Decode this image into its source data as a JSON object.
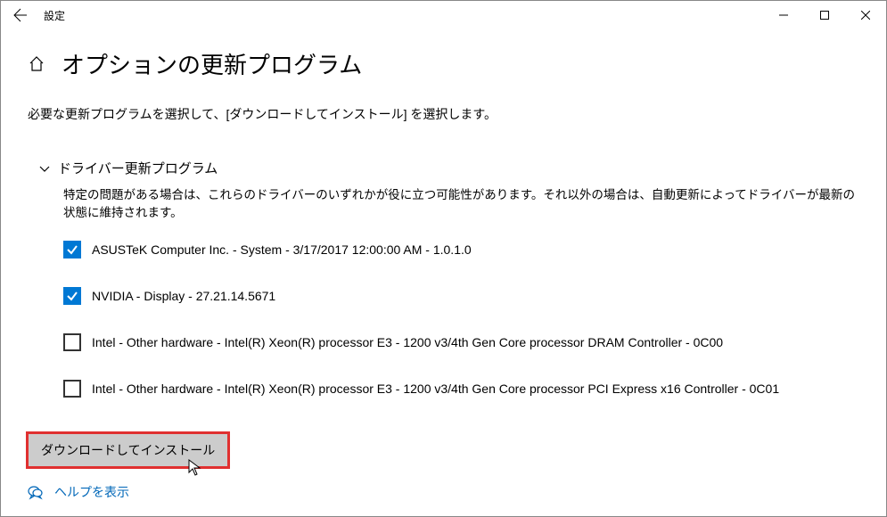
{
  "window": {
    "title": "設定"
  },
  "page": {
    "title": "オプションの更新プログラム",
    "description": "必要な更新プログラムを選択して、[ダウンロードしてインストール] を選択します。"
  },
  "section": {
    "title": "ドライバー更新プログラム",
    "description": "特定の問題がある場合は、これらのドライバーのいずれかが役に立つ可能性があります。それ以外の場合は、自動更新によってドライバーが最新の状態に維持されます。"
  },
  "updates": [
    {
      "label": "ASUSTeK Computer Inc. - System - 3/17/2017 12:00:00 AM - 1.0.1.0",
      "checked": true
    },
    {
      "label": "NVIDIA - Display - 27.21.14.5671",
      "checked": true
    },
    {
      "label": "Intel - Other hardware - Intel(R) Xeon(R) processor E3 - 1200 v3/4th Gen Core processor DRAM Controller - 0C00",
      "checked": false
    },
    {
      "label": "Intel - Other hardware - Intel(R) Xeon(R) processor E3 - 1200 v3/4th Gen Core processor PCI Express x16 Controller - 0C01",
      "checked": false
    }
  ],
  "buttons": {
    "download": "ダウンロードしてインストール"
  },
  "help": {
    "label": "ヘルプを表示"
  }
}
